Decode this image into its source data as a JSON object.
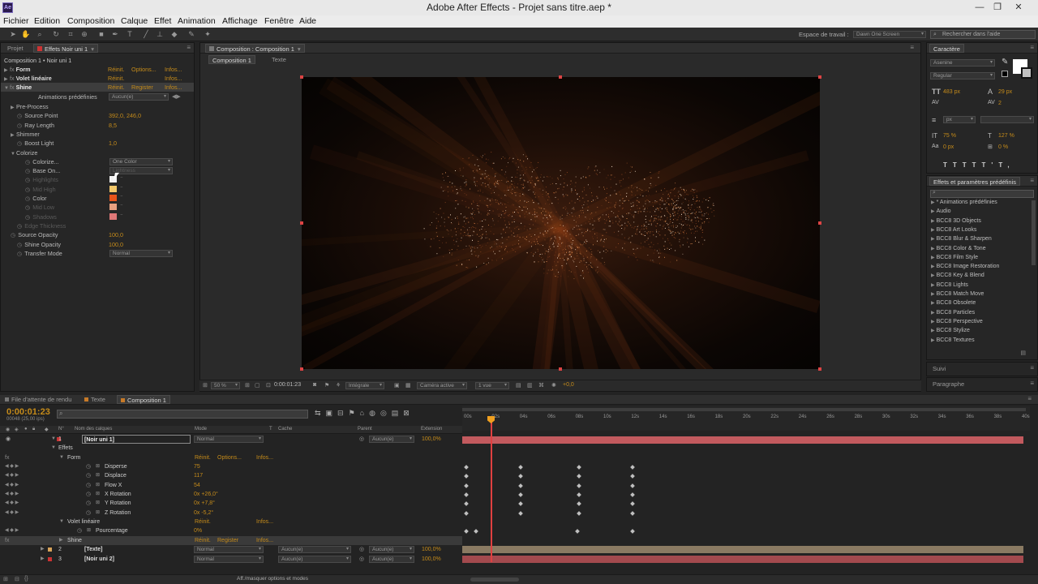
{
  "window": {
    "title": "Adobe After Effects - Projet sans titre.aep *",
    "app_icon": "Ae",
    "controls": [
      "minimize-icon",
      "restore-icon",
      "close-icon"
    ]
  },
  "menu": [
    "Fichier",
    "Edition",
    "Composition",
    "Calque",
    "Effet",
    "Animation",
    "Affichage",
    "Fenêtre",
    "Aide"
  ],
  "toolbar": {
    "workspace_label": "Espace de travail :",
    "workspace_value": "Dawn One Screen",
    "help_placeholder": "Rechercher dans l'aide"
  },
  "effects_panel": {
    "tabs": [
      "Projet",
      "Effets Noir uni 1"
    ],
    "header": "Composition 1 • Noir uni 1",
    "effects": [
      {
        "name": "Form",
        "links": [
          "Réinit.",
          "Options...",
          "Infos..."
        ]
      },
      {
        "name": "Volet linéaire",
        "links": [
          "Réinit.",
          "Infos..."
        ]
      },
      {
        "name": "Shine",
        "links": [
          "Réinit.",
          "Register",
          "Infos..."
        ]
      }
    ],
    "presets_label": "Animations prédéfinies",
    "presets_value": "Aucun(e)",
    "params": [
      {
        "label": "Pre-Process",
        "value": "",
        "kind": "group"
      },
      {
        "label": "Source Point",
        "value": "392,0, 246,0",
        "kind": "value"
      },
      {
        "label": "Ray Length",
        "value": "8,5",
        "kind": "value"
      },
      {
        "label": "Shimmer",
        "value": "",
        "kind": "group"
      },
      {
        "label": "Boost Light",
        "value": "1,0",
        "kind": "value"
      },
      {
        "label": "Colorize",
        "value": "",
        "kind": "group"
      },
      {
        "label": "Colorize...",
        "value": "One Color",
        "kind": "dropdown"
      },
      {
        "label": "Base On...",
        "value": "Lightness",
        "kind": "dropdown"
      },
      {
        "label": "Highlights",
        "value": "",
        "kind": "swatch-dim",
        "color": "#f3f3f3"
      },
      {
        "label": "Mid High",
        "value": "",
        "kind": "swatch-dim",
        "color": "#f3c86a"
      },
      {
        "label": "Color",
        "value": "",
        "kind": "swatch",
        "color": "#e8541a"
      },
      {
        "label": "Mid Low",
        "value": "",
        "kind": "swatch-dim",
        "color": "#e8a080"
      },
      {
        "label": "Shadows",
        "value": "",
        "kind": "swatch-dim",
        "color": "#e07878"
      },
      {
        "label": "Edge Thickness",
        "value": "",
        "kind": "dim"
      },
      {
        "label": "Source Opacity",
        "value": "100,0",
        "kind": "value"
      },
      {
        "label": "Shine Opacity",
        "value": "100,0",
        "kind": "value"
      },
      {
        "label": "Transfer Mode",
        "value": "Normal",
        "kind": "dropdown"
      }
    ]
  },
  "comp_panel": {
    "tab": "Composition : Composition 1",
    "subtabs": [
      "Composition 1",
      "Texte"
    ],
    "footer": {
      "zoom": "50 %",
      "time": "0:00:01:23",
      "resolution": "Intégrale",
      "camera": "Caméra active",
      "views": "1 vue",
      "exposure": "+0,0"
    }
  },
  "right_panel": {
    "char_tab": "Caractère",
    "font": "Asenine",
    "style": "Regular",
    "size": "483 px",
    "leading": "29 px",
    "unit": "px",
    "scale_v": "75 %",
    "scale_h": "127 %",
    "baseline": "0 px",
    "tsume": "0 %",
    "kerning": "2",
    "effects_tab": "Effets et paramètres prédéfinis",
    "items": [
      "* Animations prédéfinies",
      "Audio",
      "BCC8 3D Objects",
      "BCC8 Art Looks",
      "BCC8 Blur & Sharpen",
      "BCC8 Color & Tone",
      "BCC8 Film Style",
      "BCC8 Image Restoration",
      "BCC8 Key & Blend",
      "BCC8 Lights",
      "BCC8 Match Move",
      "BCC8 Obsolete",
      "BCC8 Particles",
      "BCC8 Perspective",
      "BCC8 Stylize",
      "BCC8 Textures"
    ],
    "suivi": "Suivi",
    "paragraphe": "Paragraphe"
  },
  "timeline": {
    "tabs": [
      "File d'attente de rendu",
      "Texte",
      "Composition 1"
    ],
    "timecode": "0:00:01:23",
    "frames": "00048 (25,00 ips)",
    "columns": [
      "N°",
      "Nom des calques",
      "Mode",
      "T",
      "Cache",
      "Parent",
      "Extension"
    ],
    "ruler": [
      "00s",
      "02s",
      "04s",
      "06s",
      "08s",
      "10s",
      "12s",
      "14s",
      "16s",
      "18s",
      "20s",
      "22s",
      "24s",
      "26s",
      "28s",
      "30s",
      "32s",
      "34s",
      "36s",
      "38s",
      "40s"
    ],
    "layers": [
      {
        "num": "1",
        "name": "[Noir uni 1]",
        "mode": "Normal",
        "cache": "",
        "parent": "Aucun(e)",
        "stretch": "100,0%"
      },
      {
        "num": "2",
        "name": "[Texte]",
        "mode": "Normal",
        "cache": "Aucun(e)",
        "parent": "Aucun(e)",
        "stretch": "100,0%"
      },
      {
        "num": "3",
        "name": "[Noir uni 2]",
        "mode": "Normal",
        "cache": "Aucun(e)",
        "parent": "Aucun(e)",
        "stretch": "100,0%"
      }
    ],
    "effects_label": "Effets",
    "form": {
      "name": "Form",
      "links": [
        "Réinit.",
        "Options...",
        "Infos..."
      ]
    },
    "props": [
      {
        "name": "Disperse",
        "value": "75"
      },
      {
        "name": "Displace",
        "value": "117"
      },
      {
        "name": "Flow X",
        "value": "54"
      },
      {
        "name": "X Rotation",
        "value": "0x +26,0°"
      },
      {
        "name": "Y Rotation",
        "value": "0x +7,8°"
      },
      {
        "name": "Z Rotation",
        "value": "0x -5,2°"
      }
    ],
    "volet": {
      "name": "Volet linéaire",
      "links": [
        "Réinit.",
        "Infos..."
      ]
    },
    "pourcentage": {
      "name": "Pourcentage",
      "value": "0%"
    },
    "shine": {
      "name": "Shine",
      "links": [
        "Réinit.",
        "Register",
        "Infos..."
      ]
    },
    "footer_btn": "Aff./masquer options et modes"
  }
}
